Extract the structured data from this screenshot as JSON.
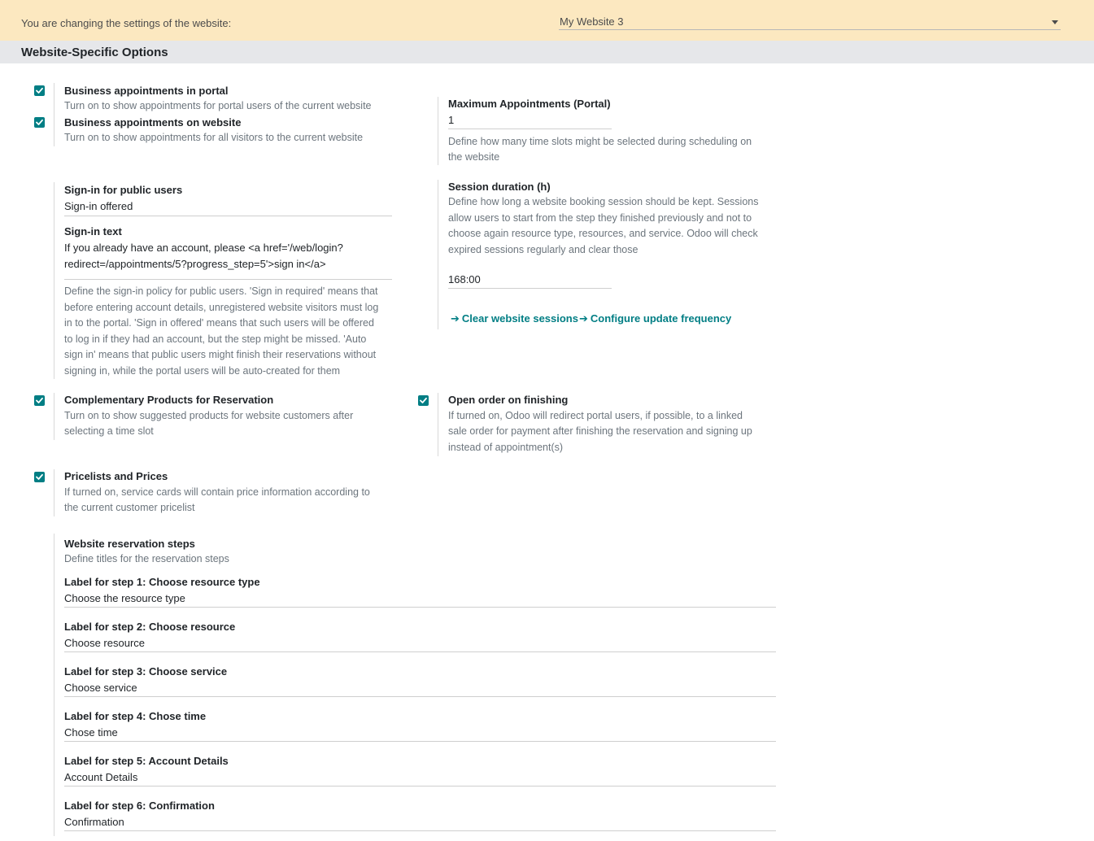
{
  "header": {
    "label": "You are changing the settings of the website:",
    "website": "My Website 3"
  },
  "section": {
    "title": "Website-Specific Options"
  },
  "settings": {
    "portal_appointments": {
      "checked": true,
      "label": "Business appointments in portal",
      "help": "Turn on to show appointments for portal users of the current website"
    },
    "website_appointments": {
      "checked": true,
      "label": "Business appointments on website",
      "help": "Turn on to show appointments for all visitors to the current website"
    },
    "max_appointments": {
      "label": "Maximum Appointments (Portal)",
      "value": "1",
      "help_lines": [
        "Define how many time slots might be selected during scheduling on",
        "the website"
      ]
    },
    "signin": {
      "label": "Sign-in for public users",
      "value": "Sign-in offered",
      "text_label": "Sign-in text",
      "text_lines": [
        "If you already have an account, please <a href='/web/login?",
        "redirect=/appointments/5?progress_step=5'>sign in</a>"
      ],
      "help_lines": [
        "Define the sign-in policy for public users. 'Sign in required' means that",
        "before entering account details, unregistered website visitors must log",
        "in to the portal. 'Sign in offered' means that such users will be offered",
        "to log in if they had an account, but the step might be missed. 'Auto",
        "sign in' means that public users might finish their reservations without",
        "signing in, while the portal users will be auto-created for them"
      ]
    },
    "session": {
      "label": "Session duration (h)",
      "help_lines": [
        "Define how long a website booking session should be kept. Sessions",
        "allow users to start from the step they finished previously and not to",
        "choose again resource type, resources, and service. Odoo will check",
        "expired sessions regularly and clear those"
      ],
      "value": "168:00",
      "clear_link": "Clear website sessions",
      "configure_link": "Configure update frequency"
    },
    "complementary": {
      "checked": true,
      "label": "Complementary Products for Reservation",
      "help_lines": [
        "Turn on to show suggested products for website customers after",
        "selecting a time slot"
      ]
    },
    "open_order": {
      "checked": true,
      "label": "Open order on finishing",
      "help_lines": [
        "If turned on, Odoo will redirect portal users, if possible, to a linked",
        "sale order for payment after finishing the reservation and signing up",
        "instead of appointment(s)"
      ]
    },
    "pricelists": {
      "checked": true,
      "label": "Pricelists and Prices",
      "help_lines": [
        "If turned on, service cards will contain price information according to",
        "the current customer pricelist"
      ]
    },
    "steps": {
      "label": "Website reservation steps",
      "help": "Define titles for the reservation steps",
      "items": [
        {
          "label": "Label for step 1: Choose resource type",
          "value": "Choose the resource type"
        },
        {
          "label": "Label for step 2: Choose resource",
          "value": "Choose resource"
        },
        {
          "label": "Label for step 3: Choose service",
          "value": "Choose service"
        },
        {
          "label": "Label for step 4: Chose time",
          "value": "Chose time"
        },
        {
          "label": "Label for step 5: Account Details",
          "value": "Account Details"
        },
        {
          "label": "Label for step 6: Confirmation",
          "value": "Confirmation"
        }
      ]
    }
  },
  "colors": {
    "banner": "#fce8c0",
    "section_header": "#e6e7ea",
    "accent": "#017e84"
  },
  "icons": {
    "checkbox": "check-icon",
    "select": "caret-down-icon",
    "link": "arrow-right-icon"
  }
}
